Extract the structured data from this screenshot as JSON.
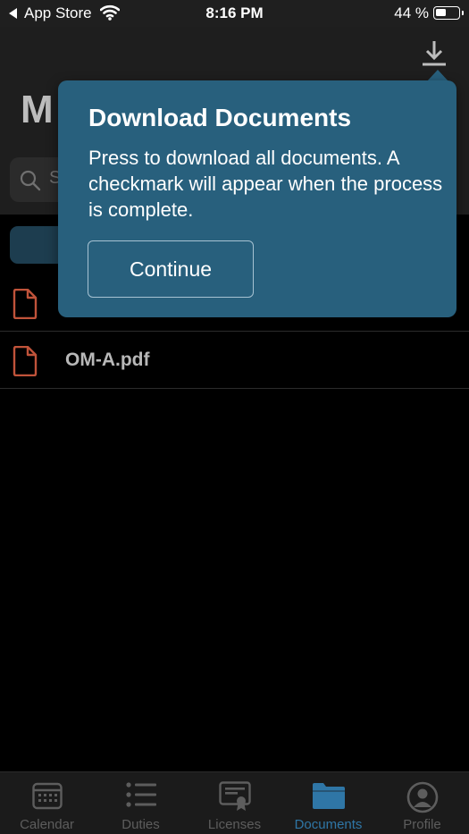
{
  "status_bar": {
    "back_label": "App Store",
    "time": "8:16 PM",
    "battery": "44 %",
    "battery_level": 0.44
  },
  "header": {
    "title_fragment": "M",
    "search_placeholder_fragment": "S"
  },
  "documents": [
    {
      "name": ""
    },
    {
      "name": "OM-A.pdf"
    }
  ],
  "popover": {
    "title": "Download Documents",
    "body": "Press to download all documents. A checkmark will appear when the process is complete.",
    "button_label": "Continue"
  },
  "tab_bar": {
    "tabs": [
      {
        "label": "Calendar",
        "icon": "calendar-icon"
      },
      {
        "label": "Duties",
        "icon": "list-icon"
      },
      {
        "label": "Licenses",
        "icon": "certificate-icon"
      },
      {
        "label": "Documents",
        "icon": "folder-icon",
        "active": true
      },
      {
        "label": "Profile",
        "icon": "profile-icon"
      }
    ]
  },
  "colors": {
    "popover_bg": "#28607d",
    "accent": "#2f76a6",
    "doc_icon": "#c0533a"
  }
}
